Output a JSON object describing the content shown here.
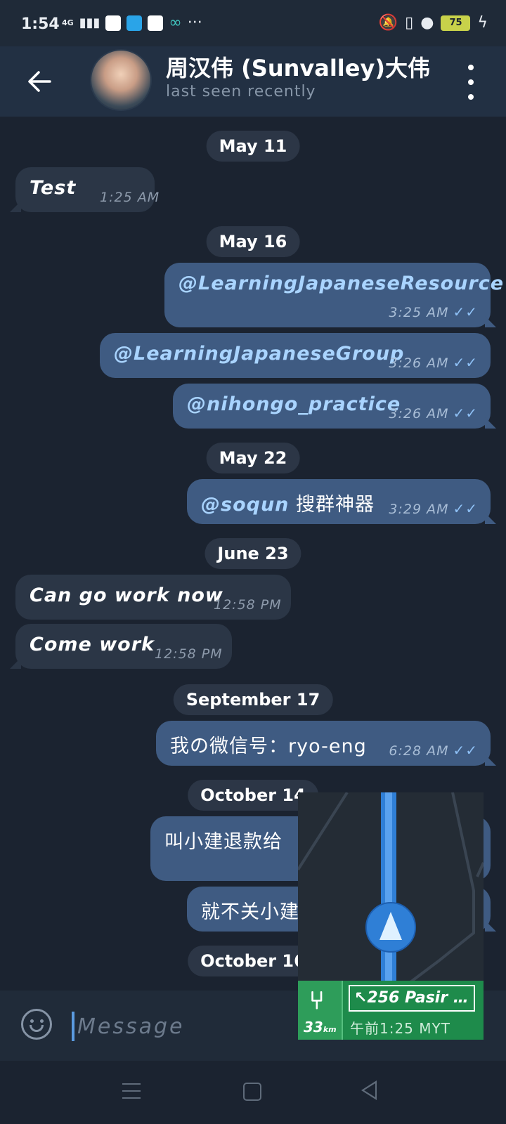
{
  "status_bar": {
    "time": "1:54",
    "network": "4G",
    "battery": "75"
  },
  "header": {
    "contact_name": "周汉伟 (Sunvalley)大伟",
    "last_seen": "last seen recently"
  },
  "messages": [
    {
      "date": "May 11"
    },
    {
      "text": "Test",
      "time": "1:25 AM",
      "direction": "in"
    },
    {
      "date": "May 16"
    },
    {
      "text": "@LearningJapaneseResource",
      "time": "3:25 AM",
      "direction": "out"
    },
    {
      "text": "@LearningJapaneseGroup",
      "time": "3:26 AM",
      "direction": "out"
    },
    {
      "text": "@nihongo_practice",
      "time": "3:26 AM",
      "direction": "out"
    },
    {
      "date": "May 22"
    },
    {
      "text_link": "@soqun",
      "text": " 搜群神器",
      "time": "3:29 AM",
      "direction": "out"
    },
    {
      "date": "June 23"
    },
    {
      "text": "Can go work now",
      "time": "12:58 PM",
      "direction": "in"
    },
    {
      "text": "Come work",
      "time": "12:58 PM",
      "direction": "in"
    },
    {
      "date": "September 17"
    },
    {
      "text": "我の微信号：ryo-eng",
      "time": "6:28 AM",
      "direction": "out"
    },
    {
      "date": "October 14"
    },
    {
      "text": "叫小建退款给",
      "direction": "out"
    },
    {
      "text": "就不关小建",
      "direction": "out"
    },
    {
      "date": "October 16"
    }
  ],
  "input": {
    "placeholder": "Message"
  },
  "map_overlay": {
    "distance": "33",
    "distance_unit": "km",
    "road": "↖256 Pasir Gud...",
    "eta": "午前1:25 MYT"
  },
  "colors": {
    "background": "#1b2330",
    "header": "#223043",
    "incoming_bubble": "#2b3646",
    "outgoing_bubble": "#3f5b82",
    "link": "#a9d4ff",
    "read_check": "#8ec0f5",
    "map_route": "#2f7fd6",
    "route_sign": "#1e8b4b"
  }
}
